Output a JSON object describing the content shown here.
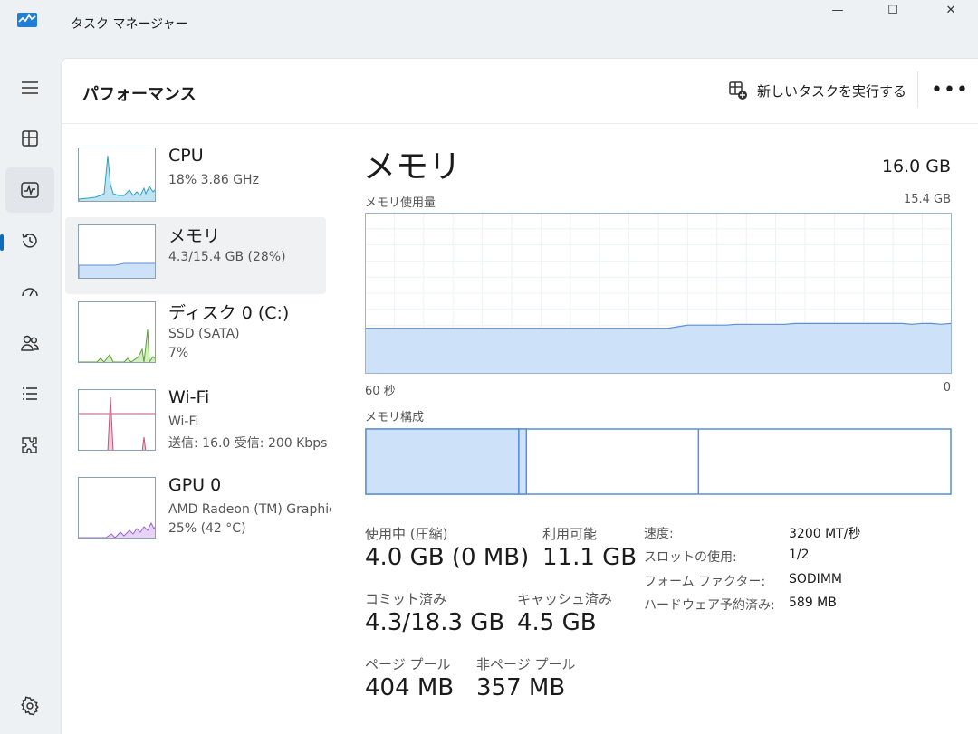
{
  "window": {
    "title": "タスク マネージャー",
    "minimize": "—",
    "maximize": "☐",
    "close": "✕"
  },
  "header": {
    "title": "パフォーマンス",
    "run_task_label": "新しいタスクを実行する",
    "more_label": "•••"
  },
  "nav": {
    "items": [
      "menu",
      "processes",
      "performance",
      "app-history",
      "startup-apps",
      "users",
      "details",
      "services",
      "settings"
    ],
    "active": "performance"
  },
  "perf_list": [
    {
      "name": "CPU",
      "line1": "18%  3.86 GHz",
      "line2": ""
    },
    {
      "name": "メモリ",
      "line1": "4.3/15.4 GB (28%)",
      "line2": ""
    },
    {
      "name": "ディスク 0 (C:)",
      "line1": "SSD (SATA)",
      "line2": "7%"
    },
    {
      "name": "Wi-Fi",
      "line1": "Wi-Fi",
      "line2": "送信: 16.0  受信: 200 Kbps"
    },
    {
      "name": "GPU 0",
      "line1": "AMD Radeon (TM) Graphics",
      "line2": "25% (42 °C)"
    }
  ],
  "memory": {
    "title": "メモリ",
    "total": "16.0 GB",
    "usage_label": "メモリ使用量",
    "usage_max": "15.4 GB",
    "axis_left": "60 秒",
    "axis_right": "0",
    "composition_label": "メモリ構成",
    "composition": {
      "in_use": 4.0,
      "modified": 0.2,
      "standby": 4.5,
      "free": 6.6
    },
    "usage_series": [
      0.28,
      0.28,
      0.28,
      0.28,
      0.28,
      0.28,
      0.28,
      0.28,
      0.28,
      0.28,
      0.28,
      0.28,
      0.28,
      0.28,
      0.28,
      0.28,
      0.28,
      0.28,
      0.28,
      0.28,
      0.28,
      0.28,
      0.28,
      0.28,
      0.28,
      0.28,
      0.28,
      0.28,
      0.28,
      0.28,
      0.28,
      0.28,
      0.29,
      0.3,
      0.3,
      0.3,
      0.3,
      0.3,
      0.305,
      0.305,
      0.305,
      0.305,
      0.305,
      0.305,
      0.31,
      0.31,
      0.31,
      0.31,
      0.31,
      0.31,
      0.31,
      0.31,
      0.31,
      0.31,
      0.31,
      0.31,
      0.305,
      0.31,
      0.31,
      0.305,
      0.31
    ],
    "stats": {
      "in_use_label": "使用中 (圧縮)",
      "in_use_value": "4.0 GB (0 MB)",
      "available_label": "利用可能",
      "available_value": "11.1 GB",
      "committed_label": "コミット済み",
      "committed_value": "4.3/18.3 GB",
      "cached_label": "キャッシュ済み",
      "cached_value": "4.5 GB",
      "paged_label": "ページ プール",
      "paged_value": "404 MB",
      "nonpaged_label": "非ページ プール",
      "nonpaged_value": "357 MB"
    },
    "props": [
      {
        "label": "速度:",
        "value": "3200 MT/秒"
      },
      {
        "label": "スロットの使用:",
        "value": "1/2"
      },
      {
        "label": "フォーム ファクター:",
        "value": "SODIMM"
      },
      {
        "label": "ハードウェア予約済み:",
        "value": "589 MB"
      }
    ]
  },
  "colors": {
    "memory_fill": "#cde1f8",
    "memory_line": "#5b8fd4",
    "cpu": "#2f9fc4",
    "disk": "#58a231",
    "wifi": "#c2547a",
    "gpu": "#9b63cf",
    "accent": "#0f6cbd"
  }
}
